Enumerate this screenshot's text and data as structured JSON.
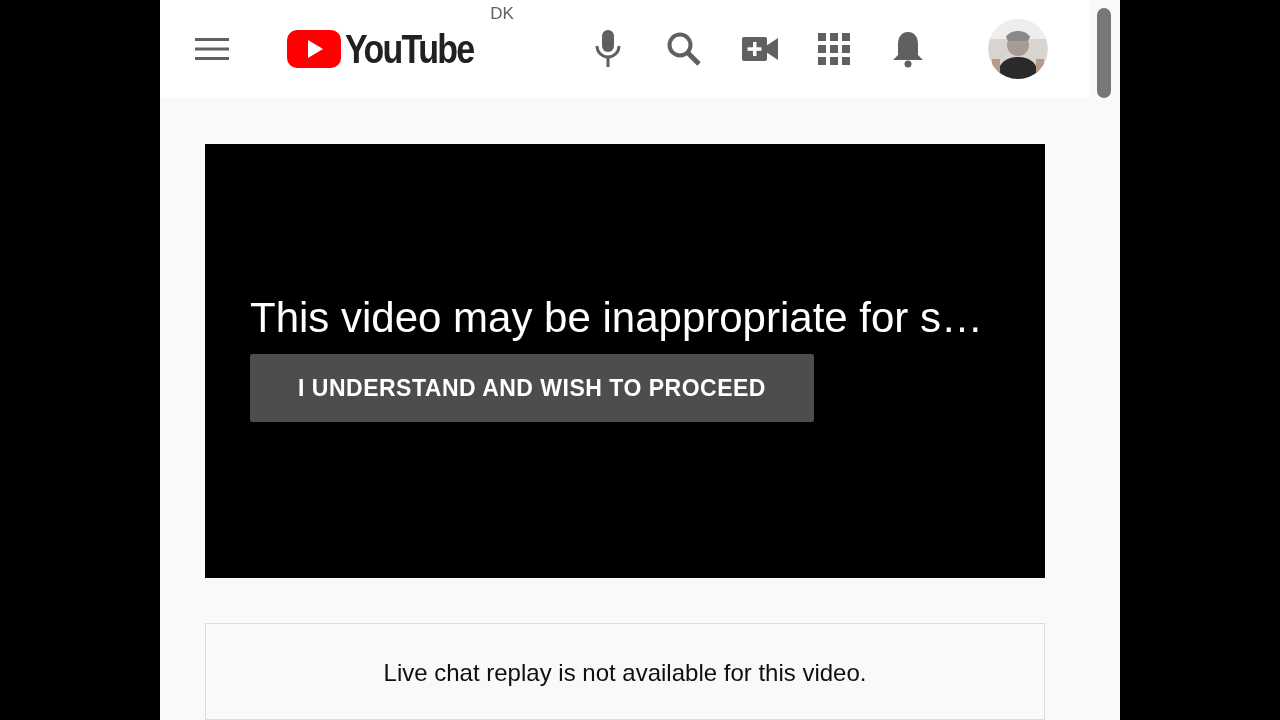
{
  "header": {
    "logo_text": "YouTube",
    "country_code": "DK"
  },
  "video": {
    "warning": "This video may be inappropriate for s…",
    "button": "I UNDERSTAND AND WISH TO PROCEED"
  },
  "chat": {
    "message": "Live chat replay is not available for this video."
  }
}
